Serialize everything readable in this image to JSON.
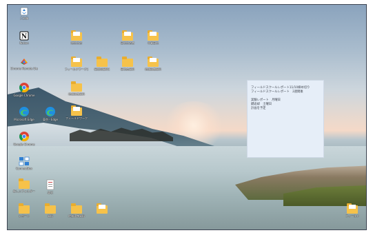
{
  "desktop": {
    "icons": [
      {
        "id": "recycle",
        "label": "ごみ箱",
        "kind": "recycle"
      },
      {
        "id": "notion",
        "label": "Notion",
        "kind": "notion"
      },
      {
        "id": "chrome-remote",
        "label": "Chrome Remote Desktop",
        "kind": "chrome-remote"
      },
      {
        "id": "chrome",
        "label": "Google Chrome",
        "kind": "chrome"
      },
      {
        "id": "edge",
        "label": "Microsoft Edge",
        "kind": "edge"
      },
      {
        "id": "edge2",
        "label": "東京 - Edge",
        "kind": "edge"
      },
      {
        "id": "chrome2",
        "label": "Google Chrome",
        "kind": "chrome"
      },
      {
        "id": "connect",
        "label": "ConnectBox",
        "kind": "connect"
      },
      {
        "id": "folder-a1",
        "label": "院生生活",
        "kind": "folder"
      },
      {
        "id": "folder-a2",
        "label": "研究生活費",
        "kind": "folder"
      },
      {
        "id": "folder-a3",
        "label": "卒業研究",
        "kind": "folder"
      },
      {
        "id": "folder-b1",
        "label": "フィールドワーク1",
        "kind": "folder"
      },
      {
        "id": "folder-b2",
        "label": "研究室資料1",
        "kind": "folder"
      },
      {
        "id": "folder-b3",
        "label": "研究会資料",
        "kind": "folder"
      },
      {
        "id": "folder-b4",
        "label": "地域連携資料",
        "kind": "folder"
      },
      {
        "id": "folder-c1",
        "label": "地域連携資料",
        "kind": "folder"
      },
      {
        "id": "folder-c2",
        "label": "フィールドワーク",
        "kind": "folder"
      },
      {
        "id": "folder-d1",
        "label": "新しいフォルダー",
        "kind": "folder"
      },
      {
        "id": "doc-1",
        "label": "論文",
        "kind": "document"
      },
      {
        "id": "folder-e1",
        "label": "レポート",
        "kind": "folder"
      },
      {
        "id": "folder-e2",
        "label": "資料",
        "kind": "folder"
      },
      {
        "id": "folder-e3",
        "label": "地域連携資料",
        "kind": "folder"
      },
      {
        "id": "folder-e4",
        "label": "",
        "kind": "folder"
      },
      {
        "id": "folder-f1",
        "label": "フィールド",
        "kind": "folder"
      }
    ]
  },
  "sticky_note": {
    "lines_top": [
      "フィールドスクールレポート11/10締め切り",
      "フィールドスクールレポート　2週間後"
    ],
    "lines_bottom": [
      "実験レポート　月曜日",
      "鍵返却　土曜日",
      "計画を予定"
    ]
  },
  "colors": {
    "folder": "#f6c24a",
    "note_bg": "#e6eef8"
  }
}
